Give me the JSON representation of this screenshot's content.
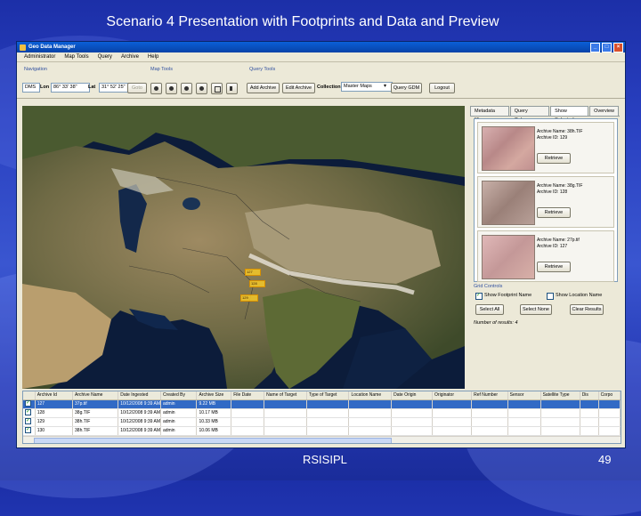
{
  "slide": {
    "title": "Scenario 4 Presentation with Footprints and Data and Preview",
    "footer_left": "RSISIPL",
    "page_number": "49"
  },
  "window": {
    "title": "Geo Data Manager",
    "menu": [
      "Administrator",
      "Map Tools",
      "Query",
      "Archive",
      "Help"
    ]
  },
  "toolbar": {
    "navigation_label": "Navigation",
    "map_tools_label": "Map Tools",
    "query_tools_label": "Query Tools",
    "coord_format": "DMS",
    "lon_label": "Lon",
    "lon_value": "86° 33' 38\"",
    "lat_label": "Lat",
    "lat_value": "31° 52' 25\"",
    "goto_label": "Goto",
    "add_archive_label": "Add Archive",
    "edit_archive_label": "Edit Archive",
    "collection_label": "Collection",
    "collection_value": "Master Maps",
    "query_gdm_label": "Query GDM",
    "logout_label": "Logout",
    "tool_icons": [
      "zoom-in-icon",
      "zoom-out-icon",
      "pan-icon",
      "globe-icon",
      "extent-icon",
      "select-icon"
    ]
  },
  "footprints": [
    "127",
    "128",
    "129"
  ],
  "right_panel": {
    "tabs": [
      "Metadata filters",
      "Query Columns",
      "Show Selected",
      "Overview"
    ],
    "active_tab": 2,
    "cards": [
      {
        "name_label": "Archive Name: 38h.TIF",
        "id_label": "Archive ID: 129",
        "button": "Retrieve"
      },
      {
        "name_label": "Archive Name: 38g.TIF",
        "id_label": "Archive ID: 128",
        "button": "Retrieve"
      },
      {
        "name_label": "Archive Name: 27p.tif",
        "id_label": "Archive ID: 127",
        "button": "Retrieve"
      }
    ],
    "grid_controls_label": "Grid Controls",
    "show_footprint_name": "Show Footprint Name",
    "show_location_name": "Show Location Name",
    "select_all": "Select All",
    "select_none": "Select None",
    "clear_results": "Clear Results",
    "num_results": "Number of results: 4"
  },
  "grid": {
    "columns": [
      "",
      "Archive Id",
      "Archive Name",
      "Date Ingested",
      "Created By",
      "Archive Size",
      "File Date",
      "Name of Target",
      "Type of Target",
      "Location Name",
      "Date Origin",
      "Originator",
      "Ref Number",
      "Sensor",
      "Satellite Type",
      "Dis",
      "Corpo"
    ],
    "rows": [
      [
        "127",
        "37p.tif",
        "10/12/2008 9:39 AM",
        "admin",
        "9.22 MB"
      ],
      [
        "128",
        "38g.TIF",
        "10/12/2008 9:39 AM",
        "admin",
        "10.17 MB"
      ],
      [
        "129",
        "38h.TIF",
        "10/12/2008 9:39 AM",
        "admin",
        "10.33 MB"
      ],
      [
        "130",
        "38h.TIF",
        "10/12/2008 9:39 AM",
        "admin",
        "10.06 MB"
      ]
    ],
    "selected_row": 0
  }
}
